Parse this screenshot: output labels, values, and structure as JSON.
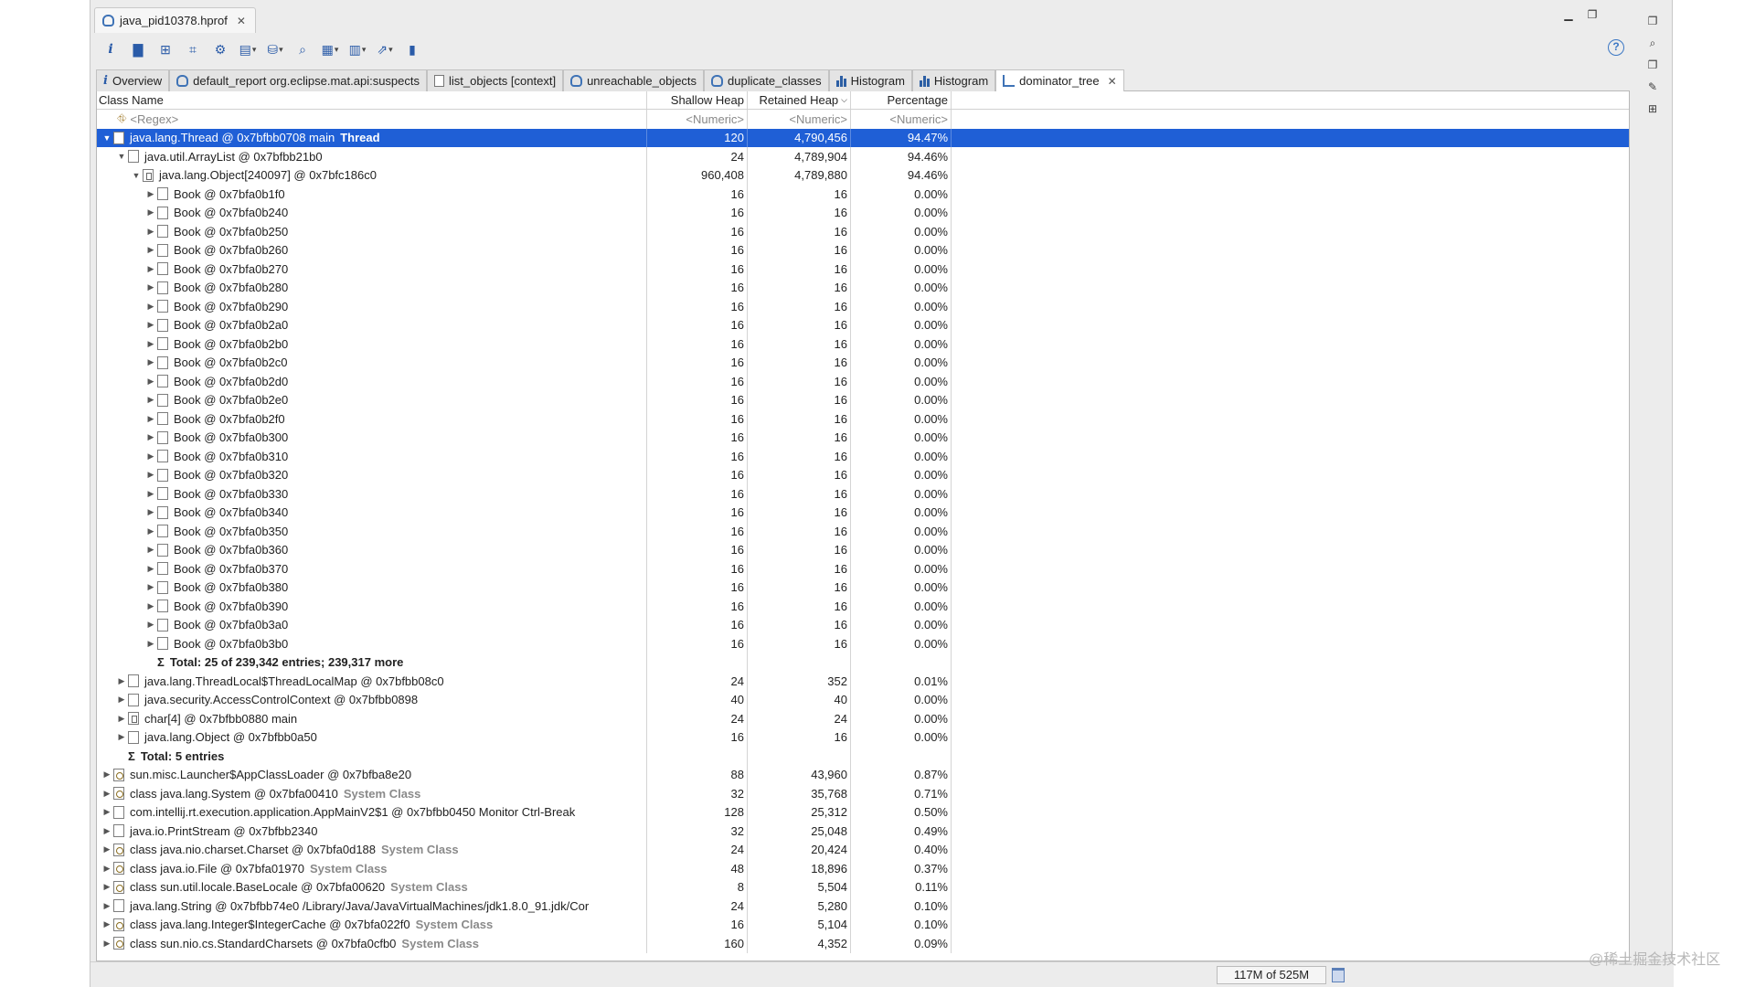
{
  "window": {
    "file_tab": "java_pid10378.hprof"
  },
  "tabs": [
    {
      "label": "Overview",
      "icon": "info-icon"
    },
    {
      "label": "default_report  org.eclipse.mat.api:suspects",
      "icon": "report-icon"
    },
    {
      "label": "list_objects [context]",
      "icon": "doc-icon"
    },
    {
      "label": "unreachable_objects",
      "icon": "report-icon"
    },
    {
      "label": "duplicate_classes",
      "icon": "report-icon"
    },
    {
      "label": "Histogram",
      "icon": "histogram-icon"
    },
    {
      "label": "Histogram",
      "icon": "histogram-icon"
    },
    {
      "label": "dominator_tree",
      "icon": "tree-icon",
      "active": true
    }
  ],
  "table": {
    "headers": {
      "name": "Class Name",
      "shallow": "Shallow Heap",
      "retained": "Retained Heap",
      "percentage": "Percentage"
    },
    "filters": {
      "name": "<Regex>",
      "shallow": "<Numeric>",
      "retained": "<Numeric>",
      "percentage": "<Numeric>"
    },
    "rows": [
      {
        "depth": 0,
        "tw": "▼",
        "icon": "obj",
        "name": "java.lang.Thread @ 0x7bfbb0708  main",
        "bold": "Thread",
        "sh": "120",
        "rt": "4,790,456",
        "pc": "94.47%",
        "sel": true
      },
      {
        "depth": 1,
        "tw": "▼",
        "icon": "obj",
        "name": "java.util.ArrayList @ 0x7bfbb21b0",
        "sh": "24",
        "rt": "4,789,904",
        "pc": "94.46%"
      },
      {
        "depth": 2,
        "tw": "▼",
        "icon": "arr",
        "name": "java.lang.Object[240097] @ 0x7bfc186c0",
        "sh": "960,408",
        "rt": "4,789,880",
        "pc": "94.46%"
      },
      {
        "depth": 3,
        "tw": "▶",
        "icon": "obj",
        "name": "Book @ 0x7bfa0b1f0",
        "sh": "16",
        "rt": "16",
        "pc": "0.00%"
      },
      {
        "depth": 3,
        "tw": "▶",
        "icon": "obj",
        "name": "Book @ 0x7bfa0b240",
        "sh": "16",
        "rt": "16",
        "pc": "0.00%"
      },
      {
        "depth": 3,
        "tw": "▶",
        "icon": "obj",
        "name": "Book @ 0x7bfa0b250",
        "sh": "16",
        "rt": "16",
        "pc": "0.00%"
      },
      {
        "depth": 3,
        "tw": "▶",
        "icon": "obj",
        "name": "Book @ 0x7bfa0b260",
        "sh": "16",
        "rt": "16",
        "pc": "0.00%"
      },
      {
        "depth": 3,
        "tw": "▶",
        "icon": "obj",
        "name": "Book @ 0x7bfa0b270",
        "sh": "16",
        "rt": "16",
        "pc": "0.00%"
      },
      {
        "depth": 3,
        "tw": "▶",
        "icon": "obj",
        "name": "Book @ 0x7bfa0b280",
        "sh": "16",
        "rt": "16",
        "pc": "0.00%"
      },
      {
        "depth": 3,
        "tw": "▶",
        "icon": "obj",
        "name": "Book @ 0x7bfa0b290",
        "sh": "16",
        "rt": "16",
        "pc": "0.00%"
      },
      {
        "depth": 3,
        "tw": "▶",
        "icon": "obj",
        "name": "Book @ 0x7bfa0b2a0",
        "sh": "16",
        "rt": "16",
        "pc": "0.00%"
      },
      {
        "depth": 3,
        "tw": "▶",
        "icon": "obj",
        "name": "Book @ 0x7bfa0b2b0",
        "sh": "16",
        "rt": "16",
        "pc": "0.00%"
      },
      {
        "depth": 3,
        "tw": "▶",
        "icon": "obj",
        "name": "Book @ 0x7bfa0b2c0",
        "sh": "16",
        "rt": "16",
        "pc": "0.00%"
      },
      {
        "depth": 3,
        "tw": "▶",
        "icon": "obj",
        "name": "Book @ 0x7bfa0b2d0",
        "sh": "16",
        "rt": "16",
        "pc": "0.00%"
      },
      {
        "depth": 3,
        "tw": "▶",
        "icon": "obj",
        "name": "Book @ 0x7bfa0b2e0",
        "sh": "16",
        "rt": "16",
        "pc": "0.00%"
      },
      {
        "depth": 3,
        "tw": "▶",
        "icon": "obj",
        "name": "Book @ 0x7bfa0b2f0",
        "sh": "16",
        "rt": "16",
        "pc": "0.00%"
      },
      {
        "depth": 3,
        "tw": "▶",
        "icon": "obj",
        "name": "Book @ 0x7bfa0b300",
        "sh": "16",
        "rt": "16",
        "pc": "0.00%"
      },
      {
        "depth": 3,
        "tw": "▶",
        "icon": "obj",
        "name": "Book @ 0x7bfa0b310",
        "sh": "16",
        "rt": "16",
        "pc": "0.00%"
      },
      {
        "depth": 3,
        "tw": "▶",
        "icon": "obj",
        "name": "Book @ 0x7bfa0b320",
        "sh": "16",
        "rt": "16",
        "pc": "0.00%"
      },
      {
        "depth": 3,
        "tw": "▶",
        "icon": "obj",
        "name": "Book @ 0x7bfa0b330",
        "sh": "16",
        "rt": "16",
        "pc": "0.00%"
      },
      {
        "depth": 3,
        "tw": "▶",
        "icon": "obj",
        "name": "Book @ 0x7bfa0b340",
        "sh": "16",
        "rt": "16",
        "pc": "0.00%"
      },
      {
        "depth": 3,
        "tw": "▶",
        "icon": "obj",
        "name": "Book @ 0x7bfa0b350",
        "sh": "16",
        "rt": "16",
        "pc": "0.00%"
      },
      {
        "depth": 3,
        "tw": "▶",
        "icon": "obj",
        "name": "Book @ 0x7bfa0b360",
        "sh": "16",
        "rt": "16",
        "pc": "0.00%"
      },
      {
        "depth": 3,
        "tw": "▶",
        "icon": "obj",
        "name": "Book @ 0x7bfa0b370",
        "sh": "16",
        "rt": "16",
        "pc": "0.00%"
      },
      {
        "depth": 3,
        "tw": "▶",
        "icon": "obj",
        "name": "Book @ 0x7bfa0b380",
        "sh": "16",
        "rt": "16",
        "pc": "0.00%"
      },
      {
        "depth": 3,
        "tw": "▶",
        "icon": "obj",
        "name": "Book @ 0x7bfa0b390",
        "sh": "16",
        "rt": "16",
        "pc": "0.00%"
      },
      {
        "depth": 3,
        "tw": "▶",
        "icon": "obj",
        "name": "Book @ 0x7bfa0b3a0",
        "sh": "16",
        "rt": "16",
        "pc": "0.00%"
      },
      {
        "depth": 3,
        "tw": "▶",
        "icon": "obj",
        "name": "Book @ 0x7bfa0b3b0",
        "sh": "16",
        "rt": "16",
        "pc": "0.00%"
      },
      {
        "depth": 3,
        "tw": "",
        "icon": "sigma",
        "name": "Total: 25 of 239,342 entries; 239,317 more",
        "total": true,
        "sh": "",
        "rt": "",
        "pc": ""
      },
      {
        "depth": 1,
        "tw": "▶",
        "icon": "obj",
        "name": "java.lang.ThreadLocal$ThreadLocalMap @ 0x7bfbb08c0",
        "sh": "24",
        "rt": "352",
        "pc": "0.01%"
      },
      {
        "depth": 1,
        "tw": "▶",
        "icon": "obj",
        "name": "java.security.AccessControlContext @ 0x7bfbb0898",
        "sh": "40",
        "rt": "40",
        "pc": "0.00%"
      },
      {
        "depth": 1,
        "tw": "▶",
        "icon": "arr",
        "name": "char[4] @ 0x7bfbb0880  main",
        "sh": "24",
        "rt": "24",
        "pc": "0.00%"
      },
      {
        "depth": 1,
        "tw": "▶",
        "icon": "obj",
        "name": "java.lang.Object @ 0x7bfbb0a50",
        "sh": "16",
        "rt": "16",
        "pc": "0.00%"
      },
      {
        "depth": 1,
        "tw": "",
        "icon": "sigma",
        "name": "Total: 5 entries",
        "total": true,
        "sh": "",
        "rt": "",
        "pc": ""
      },
      {
        "depth": 0,
        "tw": "▶",
        "icon": "cls",
        "name": "sun.misc.Launcher$AppClassLoader @ 0x7bfba8e20",
        "sh": "88",
        "rt": "43,960",
        "pc": "0.87%"
      },
      {
        "depth": 0,
        "tw": "▶",
        "icon": "cls",
        "name": "class java.lang.System @ 0x7bfa00410",
        "sys": "System Class",
        "sh": "32",
        "rt": "35,768",
        "pc": "0.71%"
      },
      {
        "depth": 0,
        "tw": "▶",
        "icon": "obj",
        "name": "com.intellij.rt.execution.application.AppMainV2$1 @ 0x7bfbb0450  Monitor Ctrl-Break",
        "sh": "128",
        "rt": "25,312",
        "pc": "0.50%"
      },
      {
        "depth": 0,
        "tw": "▶",
        "icon": "obj",
        "name": "java.io.PrintStream @ 0x7bfbb2340",
        "sh": "32",
        "rt": "25,048",
        "pc": "0.49%"
      },
      {
        "depth": 0,
        "tw": "▶",
        "icon": "cls",
        "name": "class java.nio.charset.Charset @ 0x7bfa0d188",
        "sys": "System Class",
        "sh": "24",
        "rt": "20,424",
        "pc": "0.40%"
      },
      {
        "depth": 0,
        "tw": "▶",
        "icon": "cls",
        "name": "class java.io.File @ 0x7bfa01970",
        "sys": "System Class",
        "sh": "48",
        "rt": "18,896",
        "pc": "0.37%"
      },
      {
        "depth": 0,
        "tw": "▶",
        "icon": "cls",
        "name": "class sun.util.locale.BaseLocale @ 0x7bfa00620",
        "sys": "System Class",
        "sh": "8",
        "rt": "5,504",
        "pc": "0.11%"
      },
      {
        "depth": 0,
        "tw": "▶",
        "icon": "obj",
        "name": "java.lang.String @ 0x7bfbb74e0  /Library/Java/JavaVirtualMachines/jdk1.8.0_91.jdk/Cor",
        "sh": "24",
        "rt": "5,280",
        "pc": "0.10%"
      },
      {
        "depth": 0,
        "tw": "▶",
        "icon": "cls",
        "name": "class java.lang.Integer$IntegerCache @ 0x7bfa022f0",
        "sys": "System Class",
        "sh": "16",
        "rt": "5,104",
        "pc": "0.10%"
      },
      {
        "depth": 0,
        "tw": "▶",
        "icon": "cls",
        "name": "class sun.nio.cs.StandardCharsets @ 0x7bfa0cfb0",
        "sys": "System Class",
        "sh": "160",
        "rt": "4,352",
        "pc": "0.09%"
      }
    ]
  },
  "status": {
    "heap_usage": "117M of 525M"
  },
  "watermark": "@稀土掘金技术社区",
  "colors": {
    "selection": "#1f5fd6",
    "accent": "#2a5ba8"
  }
}
